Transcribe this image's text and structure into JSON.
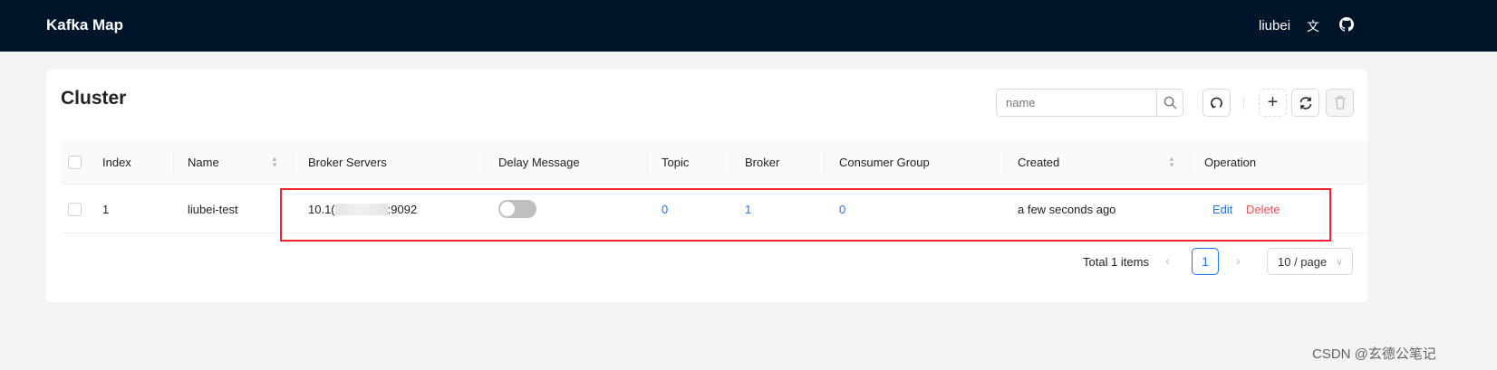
{
  "header": {
    "title": "Kafka Map",
    "user": "liubei",
    "icons": [
      "translate-icon",
      "github-icon"
    ]
  },
  "page": {
    "title": "Cluster",
    "search_placeholder": "name",
    "search_value": ""
  },
  "table": {
    "columns": [
      "Index",
      "Name",
      "Broker Servers",
      "Delay Message",
      "Topic",
      "Broker",
      "Consumer Group",
      "Created",
      "Operation"
    ],
    "rows": [
      {
        "index": "1",
        "name": "liubei-test",
        "broker_prefix": "10.1(",
        "broker_suffix": ":9092",
        "delay_message": false,
        "topic": "0",
        "broker": "1",
        "consumer_group": "0",
        "created": "a few seconds ago",
        "edit": "Edit",
        "delete": "Delete"
      }
    ]
  },
  "pagination": {
    "total": "Total 1 items",
    "current": "1",
    "prev": "‹",
    "next": "›",
    "page_size": "10 / page"
  },
  "watermark": "CSDN @玄德公笔记",
  "colors": {
    "header": "#001529",
    "primary": "#1677ff",
    "danger": "#ff4d4f",
    "highlight": "#f5222d"
  }
}
